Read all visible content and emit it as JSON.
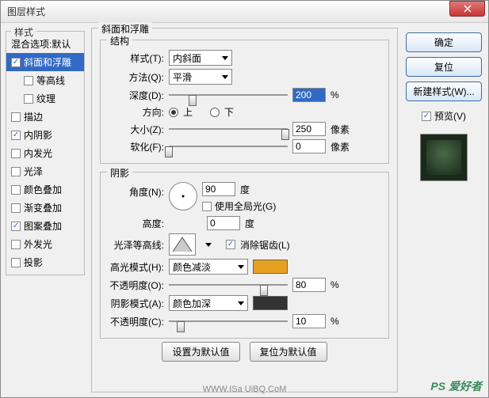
{
  "dialog": {
    "title": "图层样式"
  },
  "left": {
    "header": "样式",
    "items": [
      {
        "label": "混合选项:默认",
        "checkbox": false,
        "checked": false,
        "selected": false,
        "sub": false
      },
      {
        "label": "斜面和浮雕",
        "checkbox": true,
        "checked": true,
        "selected": true,
        "sub": false
      },
      {
        "label": "等高线",
        "checkbox": true,
        "checked": false,
        "selected": false,
        "sub": true
      },
      {
        "label": "纹理",
        "checkbox": true,
        "checked": false,
        "selected": false,
        "sub": true
      },
      {
        "label": "描边",
        "checkbox": true,
        "checked": false,
        "selected": false,
        "sub": false
      },
      {
        "label": "内阴影",
        "checkbox": true,
        "checked": true,
        "selected": false,
        "sub": false
      },
      {
        "label": "内发光",
        "checkbox": true,
        "checked": false,
        "selected": false,
        "sub": false
      },
      {
        "label": "光泽",
        "checkbox": true,
        "checked": false,
        "selected": false,
        "sub": false
      },
      {
        "label": "颜色叠加",
        "checkbox": true,
        "checked": false,
        "selected": false,
        "sub": false
      },
      {
        "label": "渐变叠加",
        "checkbox": true,
        "checked": false,
        "selected": false,
        "sub": false
      },
      {
        "label": "图案叠加",
        "checkbox": true,
        "checked": true,
        "selected": false,
        "sub": false
      },
      {
        "label": "外发光",
        "checkbox": true,
        "checked": false,
        "selected": false,
        "sub": false
      },
      {
        "label": "投影",
        "checkbox": true,
        "checked": false,
        "selected": false,
        "sub": false
      }
    ]
  },
  "center": {
    "group_title": "斜面和浮雕",
    "structure": {
      "title": "结构",
      "style_label": "样式(T):",
      "style_value": "内斜面",
      "technique_label": "方法(Q):",
      "technique_value": "平滑",
      "depth_label": "深度(D):",
      "depth_value": "200",
      "depth_unit": "%",
      "direction_label": "方向:",
      "up_label": "上",
      "down_label": "下",
      "size_label": "大小(Z):",
      "size_value": "250",
      "size_unit": "像素",
      "soften_label": "软化(F):",
      "soften_value": "0",
      "soften_unit": "像素"
    },
    "shadow": {
      "title": "阴影",
      "angle_label": "角度(N):",
      "angle_value": "90",
      "angle_unit": "度",
      "global_light_label": "使用全局光(G)",
      "altitude_label": "高度:",
      "altitude_value": "0",
      "altitude_unit": "度",
      "gloss_label": "光泽等高线:",
      "antialias_label": "消除锯齿(L)",
      "highlight_mode_label": "高光模式(H):",
      "highlight_mode_value": "颜色减淡",
      "highlight_color": "#e8a020",
      "highlight_opacity_label": "不透明度(O):",
      "highlight_opacity_value": "80",
      "highlight_opacity_unit": "%",
      "shadow_mode_label": "阴影模式(A):",
      "shadow_mode_value": "颜色加深",
      "shadow_color": "#333333",
      "shadow_opacity_label": "不透明度(C):",
      "shadow_opacity_value": "10",
      "shadow_opacity_unit": "%"
    },
    "buttons": {
      "default": "设置为默认值",
      "reset": "复位为默认值"
    }
  },
  "right": {
    "ok": "确定",
    "cancel": "复位",
    "new_style": "新建样式(W)...",
    "preview_label": "预览(V)"
  },
  "watermark": "PS 爱好者",
  "watermark2": "WWW.ISa UiBQ.CoM"
}
